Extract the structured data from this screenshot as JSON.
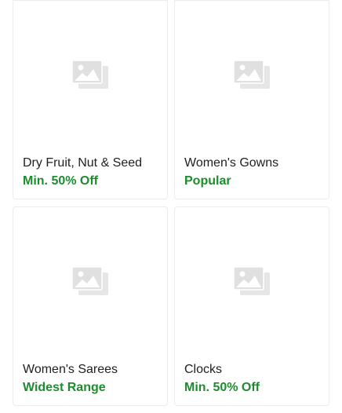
{
  "products": [
    {
      "name": "Dry Fruit, Nut & Seed",
      "tag": "Min. 50% Off",
      "icon": "image-placeholder-icon"
    },
    {
      "name": "Women's Gowns",
      "tag": "Popular",
      "icon": "image-placeholder-icon"
    },
    {
      "name": "Women's Sarees",
      "tag": "Widest Range",
      "icon": "image-placeholder-icon"
    },
    {
      "name": "Clocks",
      "tag": "Min. 50% Off",
      "icon": "image-placeholder-icon"
    }
  ],
  "colors": {
    "tag_green": "#1e8b2e",
    "placeholder_gray": "#e3e3e3",
    "card_border": "#ececec"
  }
}
